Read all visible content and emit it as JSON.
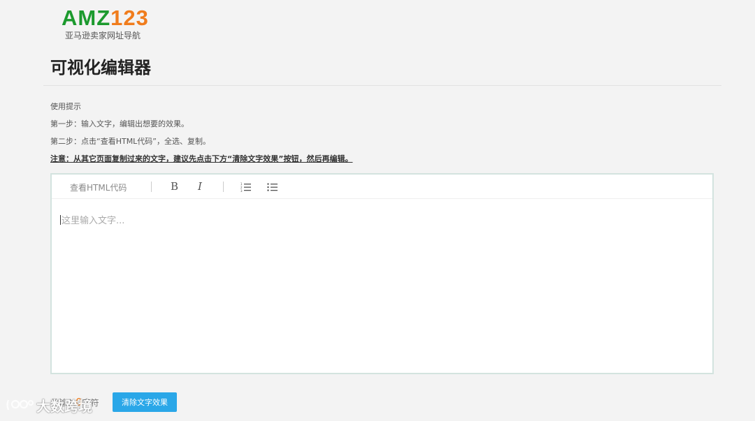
{
  "logo": {
    "mark_amz": "AMZ",
    "mark_num": "123",
    "subtitle": "亚马逊卖家网址导航"
  },
  "page": {
    "title": "可视化编辑器"
  },
  "tips": {
    "heading": "使用提示",
    "step1": "第一步：输入文字，编辑出想要的效果。",
    "step2": "第二步：点击“查看HTML代码”，全选、复制。",
    "note": "注意：从其它页面复制过来的文字，建议先点击下方“清除文字效果”按钮，然后再编辑。"
  },
  "toolbar": {
    "view_html_label": "查看HTML代码",
    "bold_label": "B",
    "italic_label": "I",
    "ordered_list_icon": "ordered-list-icon",
    "unordered_list_icon": "unordered-list-icon"
  },
  "editor": {
    "placeholder": "这里输入文字..."
  },
  "footer": {
    "counter_prefix": "共输入",
    "counter_value": "0",
    "counter_suffix": "字符",
    "clear_button_label": "清除文字效果"
  },
  "watermark": {
    "text": "大数跨境"
  },
  "colors": {
    "background": "#f3f3f3",
    "logo_green": "#1c9a2e",
    "logo_orange": "#f07c1c",
    "button_blue": "#2aa7e8",
    "editor_border": "#d3e3df"
  }
}
